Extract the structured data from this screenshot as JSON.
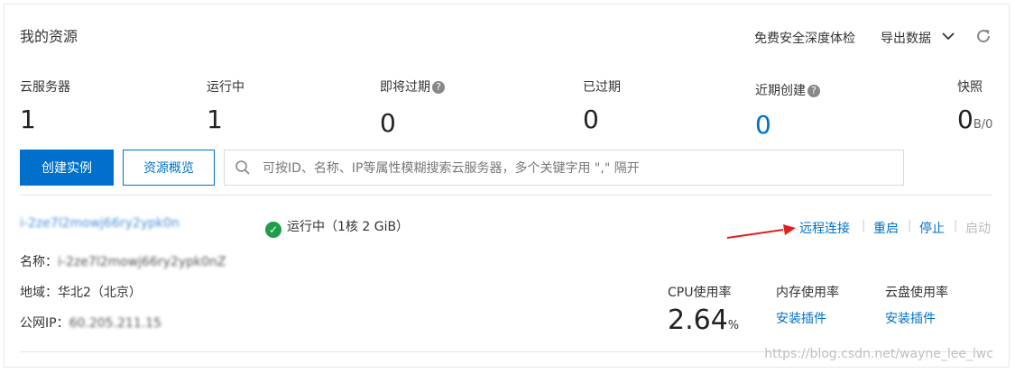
{
  "header": {
    "title": "我的资源",
    "deep_check_label": "免费安全深度体检",
    "export_label": "导出数据"
  },
  "stats": [
    {
      "label": "云服务器",
      "value": "1",
      "help": false,
      "highlight": false
    },
    {
      "label": "运行中",
      "value": "1",
      "help": false,
      "highlight": false
    },
    {
      "label": "即将过期",
      "value": "0",
      "help": true,
      "highlight": false
    },
    {
      "label": "已过期",
      "value": "0",
      "help": false,
      "highlight": false
    },
    {
      "label": "近期创建",
      "value": "0",
      "help": true,
      "highlight": true
    },
    {
      "label": "快照",
      "value": "0",
      "unit": "B/0",
      "help": false,
      "highlight": false
    }
  ],
  "toolbar": {
    "create_label": "创建实例",
    "overview_label": "资源概览",
    "search_placeholder": "可按ID、名称、IP等属性模糊搜索云服务器，多个关键字用 \",\" 隔开"
  },
  "instance": {
    "id": "i-2ze7l2mowj66ry2ypk0n",
    "status": "运行中",
    "spec": "（1核 2 GiB）",
    "actions": [
      "远程连接",
      "重启",
      "停止",
      "启动"
    ],
    "name_label": "名称：",
    "name_value": "i-2ze7l2mowj66ry2ypk0nZ",
    "region_label": "地域：",
    "region_value": "华北2（北京）",
    "ip_label": "公网IP：",
    "ip_value": "60.205.211.15"
  },
  "metrics": {
    "cpu_label": "CPU使用率",
    "cpu_value": "2.64",
    "cpu_unit": "%",
    "mem_label": "内存使用率",
    "mem_action": "安装插件",
    "disk_label": "云盘使用率",
    "disk_action": "安装插件"
  },
  "watermark": "https://blog.csdn.net/wayne_lee_lwc",
  "colors": {
    "accent": "#0070cc",
    "success": "#1e9e4a",
    "disabled": "#bbbbbb",
    "annotation_arrow": "#e02020"
  }
}
